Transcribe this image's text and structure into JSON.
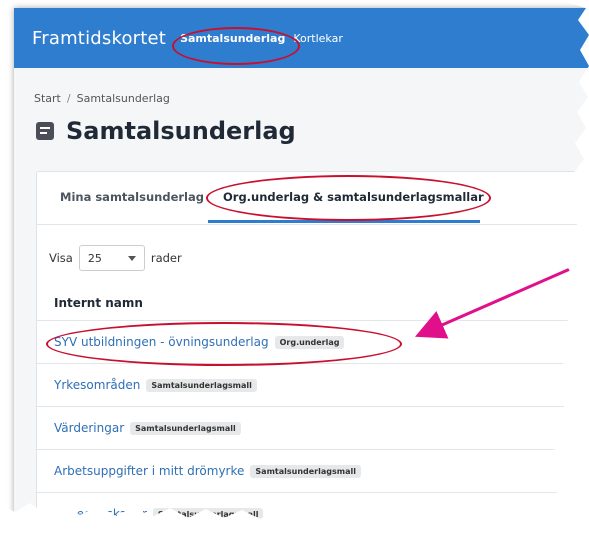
{
  "brand": "Framtidskortet",
  "nav": [
    {
      "label": "Samtalsunderlag",
      "active": true
    },
    {
      "label": "Kortlekar",
      "active": false
    }
  ],
  "breadcrumb": {
    "home": "Start",
    "separator": "/",
    "current": "Samtalsunderlag"
  },
  "page_title": "Samtalsunderlag",
  "tabs": [
    {
      "label": "Mina samtalsunderlag",
      "active": false
    },
    {
      "label": "Org.underlag & samtalsunderlagsmallar",
      "active": true
    }
  ],
  "visa": {
    "before": "Visa",
    "value": "25",
    "after": "rader"
  },
  "table": {
    "header": "Internt namn",
    "rows": [
      {
        "name": "SYV utbildningen - övningsunderlag",
        "badge": "Org.underlag"
      },
      {
        "name": "Yrkesområden",
        "badge": "Samtalsunderlagsmall"
      },
      {
        "name": "Värderingar",
        "badge": "Samtalsunderlagsmall"
      },
      {
        "name": "Arbetsuppgifter i mitt drömyrke",
        "badge": "Samtalsunderlagsmall"
      },
      {
        "name": "...a egenskaper",
        "badge": "Samtalsunderlagsmall"
      }
    ]
  },
  "colors": {
    "topbar": "#2f7dcf",
    "link": "#2f6fb6",
    "annotation_red": "#c8102e",
    "arrow_magenta": "#e0108a"
  }
}
